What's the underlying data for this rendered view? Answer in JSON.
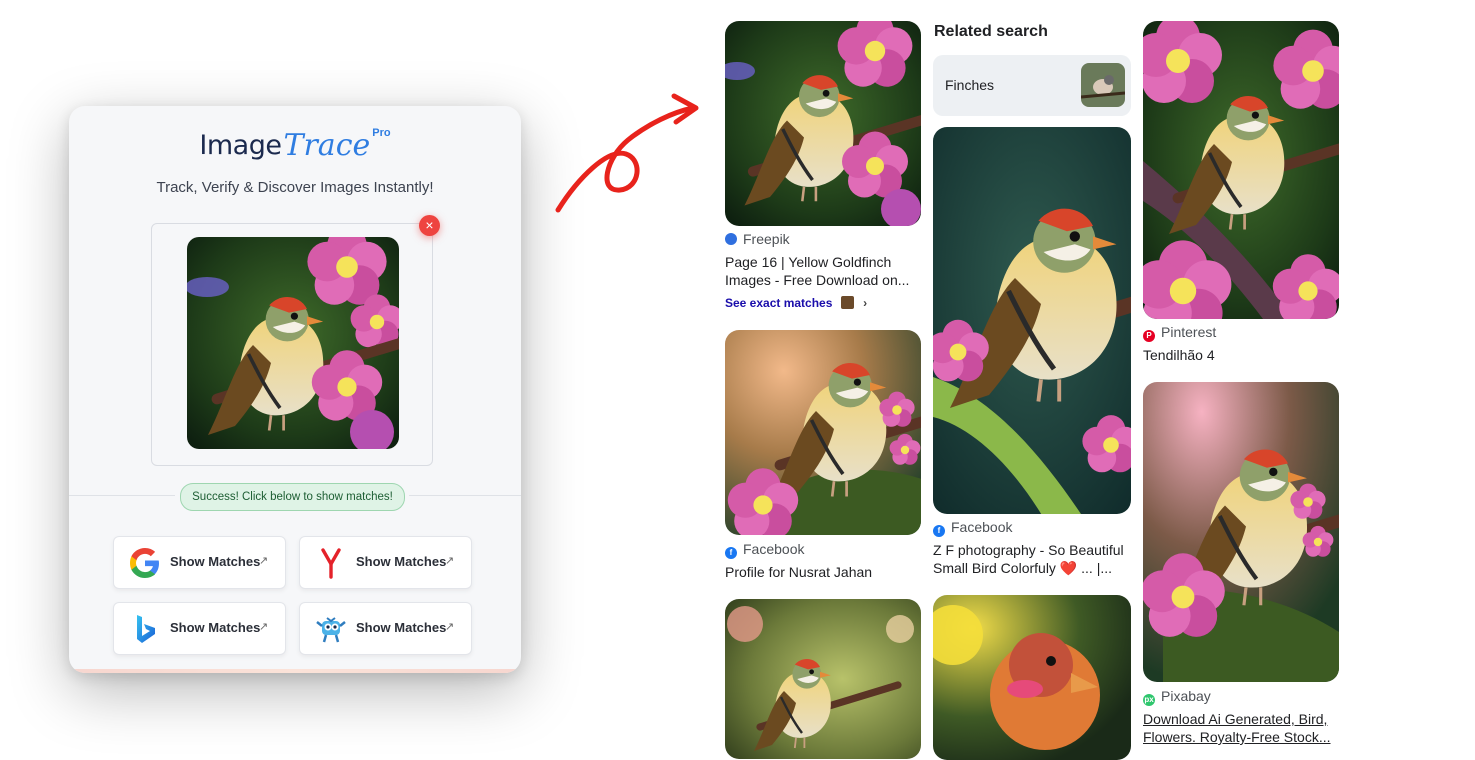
{
  "extension": {
    "logo_main": "Image",
    "logo_accent": "Trace",
    "logo_badge": "Pro",
    "tagline": "Track, Verify & Discover Images Instantly!",
    "remove_icon": "×",
    "status_message": "Success! Click below to show matches!",
    "engines": [
      {
        "name": "google",
        "label": "Show Matches",
        "arrow": "↗"
      },
      {
        "name": "yandex",
        "label": "Show Matches",
        "arrow": "↗"
      },
      {
        "name": "bing",
        "label": "Show Matches",
        "arrow": "↗"
      },
      {
        "name": "tineye",
        "label": "Show Matches",
        "arrow": "↗"
      }
    ]
  },
  "results": {
    "related_heading": "Related search",
    "related_chip_label": "Finches",
    "items": [
      {
        "source": "Freepik",
        "title_line1": "Page 16 | Yellow Goldfinch",
        "title_line2": "Images - Free Download on...",
        "exact_matches": "See exact matches",
        "chevron": "›"
      },
      {
        "source": "Facebook",
        "title_line1": "Profile for Nusrat Jahan"
      },
      {
        "source": "Facebook",
        "title_line1": "Z F photography - So Beautiful",
        "title_line2": "Small Bird Colorfuly ❤️ ... |..."
      },
      {
        "source": "Pinterest",
        "title_line1": "Tendilhão 4"
      },
      {
        "source": "Pixabay",
        "title_line1": "Download Ai Generated, Bird,",
        "title_line2": "Flowers. Royalty-Free Stock..."
      }
    ]
  },
  "colors": {
    "accent_blue": "#2f7de1",
    "remove_red": "#ee4440",
    "success_green": "#dff3e6",
    "arrow_red": "#e8231c",
    "link_blue": "#1a0dab"
  }
}
